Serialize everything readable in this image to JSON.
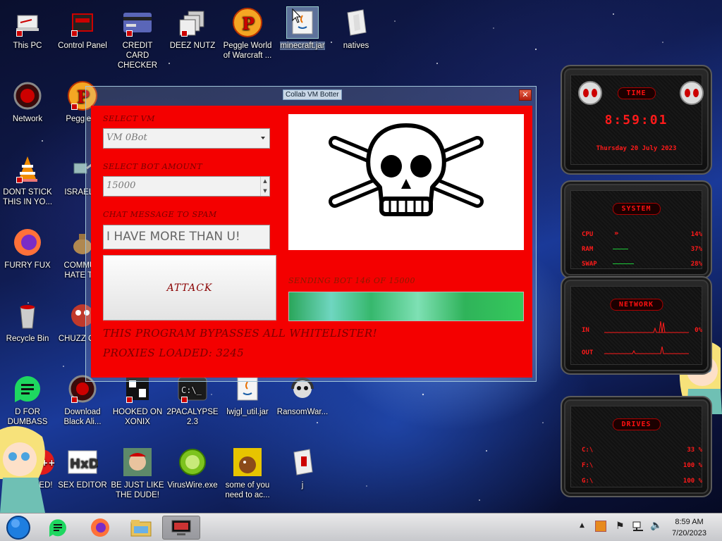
{
  "desktop": {
    "icons": [
      {
        "label": "This PC"
      },
      {
        "label": "Control Panel"
      },
      {
        "label": "CREDIT CARD CHECKER"
      },
      {
        "label": "DEEZ NUTZ"
      },
      {
        "label": "Peggle World of Warcraft ..."
      },
      {
        "label": "minecraft.jar"
      },
      {
        "label": "natives"
      },
      {
        "label": "Network"
      },
      {
        "label": "Peggle D"
      },
      {
        "label": "DONT STICK THIS IN YO..."
      },
      {
        "label": "ISRAEL S"
      },
      {
        "label": "FURRY FUX"
      },
      {
        "label": "COMMUN HATE THI"
      },
      {
        "label": "Recycle Bin"
      },
      {
        "label": "CHUZZ CUM"
      },
      {
        "label": "D FOR DUMBASS"
      },
      {
        "label": "Download Black Ali..."
      },
      {
        "label": "HOOKED ON XONIX"
      },
      {
        "label": "2PACALYPSE 2.3"
      },
      {
        "label": "lwjgl_util.jar"
      },
      {
        "label": "RansomWar..."
      },
      {
        "label": "USED!"
      },
      {
        "label": "SEX EDITOR"
      },
      {
        "label": "BE JUST LIKE THE DUDE!"
      },
      {
        "label": "VirusWire.exe"
      },
      {
        "label": "some of you need to ac..."
      },
      {
        "label": "j"
      }
    ]
  },
  "bot_window": {
    "title": "Collab VM Botter",
    "close_label": "✕",
    "select_vm_label": "SELECT VM",
    "select_vm_value": "VM 0Bot",
    "bot_amount_label": "SELECT BOT AMOUNT",
    "bot_amount_value": "15000",
    "chat_label": "CHAT MESSAGE TO SPAM",
    "chat_value": "I HAVE MORE THAN U!",
    "attack_label": "ATTACK",
    "status_text": "SENDING BOT 146 OF 15000",
    "progress": 1.0,
    "bypass_text": "THIS PROGRAM BYPASSES ALL WHITELISTER!",
    "proxies_text": "PROXIES LOADED: 3245"
  },
  "gadgets": {
    "time": {
      "header": "TIME",
      "clock": "8:59:01",
      "date": "Thursday 20 July 2023"
    },
    "system": {
      "header": "SYSTEM",
      "rows": [
        {
          "label": "CPU",
          "value": "14%"
        },
        {
          "label": "RAM",
          "value": "37%"
        },
        {
          "label": "SWAP",
          "value": "28%"
        }
      ]
    },
    "network": {
      "header": "NETWORK",
      "rows": [
        {
          "label": "IN",
          "value": "0%"
        },
        {
          "label": "OUT",
          "value": ""
        }
      ]
    },
    "drives": {
      "header": "DRIVES",
      "rows": [
        {
          "label": "C:\\",
          "value": "33 %"
        },
        {
          "label": "F:\\",
          "value": "100 %"
        },
        {
          "label": "G:\\",
          "value": "100 %"
        }
      ]
    }
  },
  "taskbar": {
    "time": "8:59 AM",
    "date": "7/20/2023"
  },
  "colors": {
    "panel_red": "#f40000",
    "label_dark_red": "#7a0000",
    "gadget_red": "#ff1a1a"
  }
}
